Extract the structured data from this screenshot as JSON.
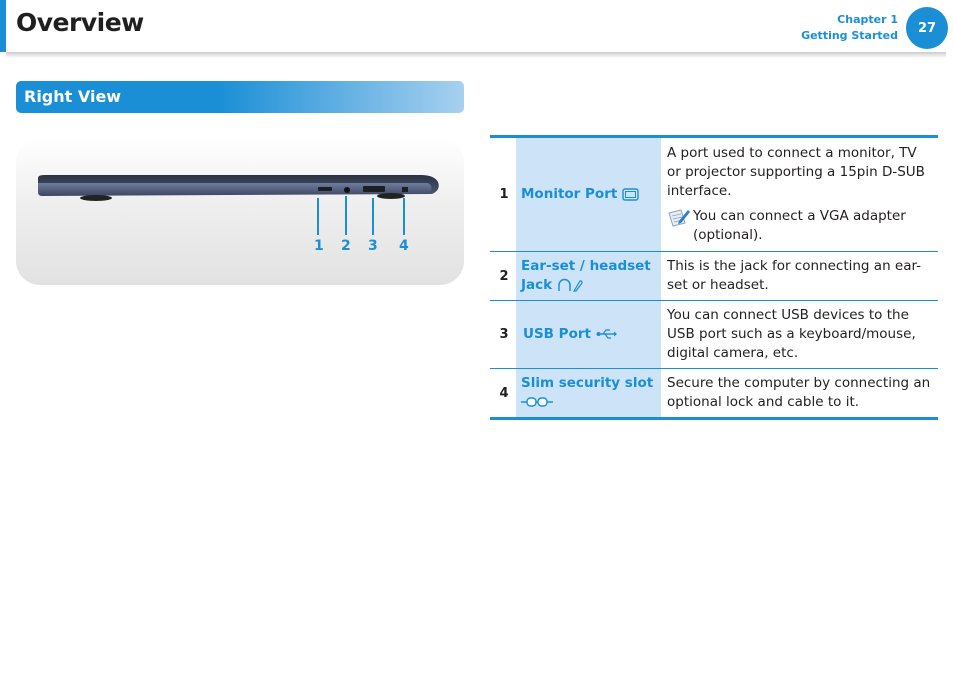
{
  "header": {
    "title": "Overview",
    "chapter_label": "Chapter 1",
    "chapter_name": "Getting Started",
    "page_number": "27"
  },
  "section": {
    "title": "Right View"
  },
  "figure": {
    "callouts": [
      "1",
      "2",
      "3",
      "4"
    ]
  },
  "ports": [
    {
      "number": "1",
      "name": "Monitor Port",
      "icon": "monitor-icon",
      "description": "A port used to connect a monitor, TV or projector supporting a 15pin D-SUB interface.",
      "note": "You can connect a VGA adapter (optional)."
    },
    {
      "number": "2",
      "name": "Ear-set / headset Jack",
      "icon": "headset-mic-icon",
      "description": "This is the jack for connecting an ear-set or headset."
    },
    {
      "number": "3",
      "name": "USB Port",
      "icon": "usb-icon",
      "description": "You can connect USB devices to the USB port such as a keyboard/mouse, digital camera, etc."
    },
    {
      "number": "4",
      "name": "Slim security slot",
      "icon": "security-lock-icon",
      "description": "Secure the computer by connecting an optional lock and cable to it."
    }
  ],
  "colors": {
    "accent": "#1a8fd6",
    "name_cell_bg": "#cde3f7"
  }
}
